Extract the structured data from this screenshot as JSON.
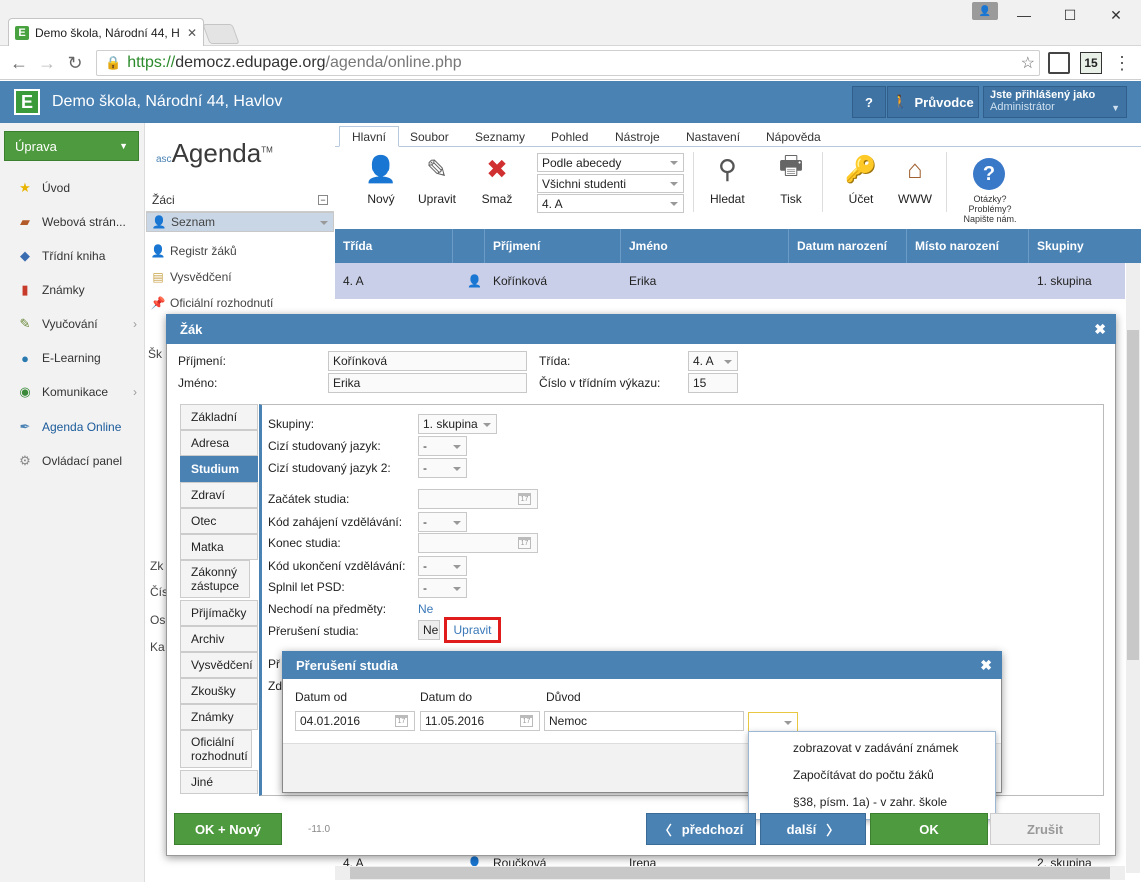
{
  "browser": {
    "tab_title": "Demo škola, Národní 44, H",
    "url_scheme": "https://",
    "url_host": "democz.edupage.org",
    "url_path": "/agenda/online.php",
    "ext_badge": "15"
  },
  "header": {
    "school_name": "Demo škola, Národní 44, Havlov",
    "help_label": "?",
    "guide_label": "Průvodce",
    "user_title": "Jste přihlášený jako",
    "user_role": "Administrátor"
  },
  "sidebar": {
    "edit_button": "Úprava",
    "items": [
      {
        "label": "Úvod"
      },
      {
        "label": "Webová strán..."
      },
      {
        "label": "Třídní kniha"
      },
      {
        "label": "Známky"
      },
      {
        "label": "Vyučování"
      },
      {
        "label": "E-Learning"
      },
      {
        "label": "Komunikace"
      },
      {
        "label": "Agenda Online"
      },
      {
        "label": "Ovládací panel"
      }
    ]
  },
  "agenda": {
    "logo_prefix": "asc",
    "logo": "Agenda",
    "logo_tm": "TM",
    "section": "Žáci",
    "items": [
      {
        "label": "Seznam"
      },
      {
        "label": "Registr žáků"
      },
      {
        "label": "Vysvědčení"
      },
      {
        "label": "Oficiální rozhodnutí"
      }
    ],
    "partial": [
      "Šk",
      "Zk",
      "Čís",
      "Os",
      "Ka"
    ]
  },
  "ribbon": {
    "tabs": [
      "Hlavní",
      "Soubor",
      "Seznamy",
      "Pohled",
      "Nástroje",
      "Nastavení",
      "Nápověda"
    ],
    "new": "Nový",
    "edit": "Upravit",
    "delete": "Smaž",
    "sort_select": "Podle abecedy",
    "filter_select": "Všichni studenti",
    "class_select": "4. A",
    "find": "Hledat",
    "print": "Tisk",
    "account": "Účet",
    "www": "WWW",
    "help_note": "Otázky? Problémy? Napište nám."
  },
  "table": {
    "headers": [
      "Třída",
      "",
      "Příjmení",
      "Jméno",
      "Datum narození",
      "Místo narození",
      "Skupiny"
    ],
    "rows": [
      {
        "trida": "4. A",
        "prijmeni": "Kořínková",
        "jmeno": "Erika",
        "skupiny": "1. skupina"
      },
      {
        "trida": "4. A",
        "prijmeni": "Roučková",
        "jmeno": "Irena",
        "skupiny": "2. skupina"
      }
    ]
  },
  "student_modal": {
    "title": "Žák",
    "surname_label": "Příjmení:",
    "surname": "Kořínková",
    "name_label": "Jméno:",
    "name": "Erika",
    "class_label": "Třída:",
    "class_value": "4. A",
    "number_label": "Číslo v třídním výkazu:",
    "number_value": "15",
    "tabs": [
      "Základní",
      "Adresa",
      "Studium",
      "Zdraví",
      "Otec",
      "Matka",
      "Zákonný zástupce",
      "Přijímačky",
      "Archiv",
      "Vysvědčení",
      "Zkoušky",
      "Známky",
      "Oficiální rozhodnutí",
      "Jiné"
    ],
    "fields": {
      "groups_label": "Skupiny:",
      "groups_value": "1. skupina",
      "lang1_label": "Cizí studovaný jazyk:",
      "lang2_label": "Cizí studovaný jazyk 2:",
      "dash": "-",
      "start_label": "Začátek studia:",
      "start_code_label": "Kód zahájení vzdělávání:",
      "end_label": "Konec studia:",
      "end_code_label": "Kód ukončení vzdělávání:",
      "psd_label": "Splnil let PSD:",
      "absent_label": "Nechodí na předměty:",
      "absent_value": "Ne",
      "interrupt_label": "Přerušení studia:",
      "interrupt_value": "Ne",
      "interrupt_edit": "Upravit",
      "hidden1": "Př",
      "hidden2": "Zd"
    },
    "footer": {
      "ok_new": "OK + Nový",
      "version": "-11.0",
      "prev": "předchozí",
      "next": "další",
      "ok": "OK",
      "cancel": "Zrušit"
    }
  },
  "interrupt_modal": {
    "title": "Přerušení studia",
    "from_label": "Datum od",
    "to_label": "Datum do",
    "reason_label": "Důvod",
    "from": "04.01.2016",
    "to": "11.05.2016",
    "reason": "Nemoc",
    "options": [
      "zobrazovat v zadávání známek",
      "Započítávat do počtu žáků",
      "§38, písm. 1a) - v zahr. škole"
    ]
  }
}
